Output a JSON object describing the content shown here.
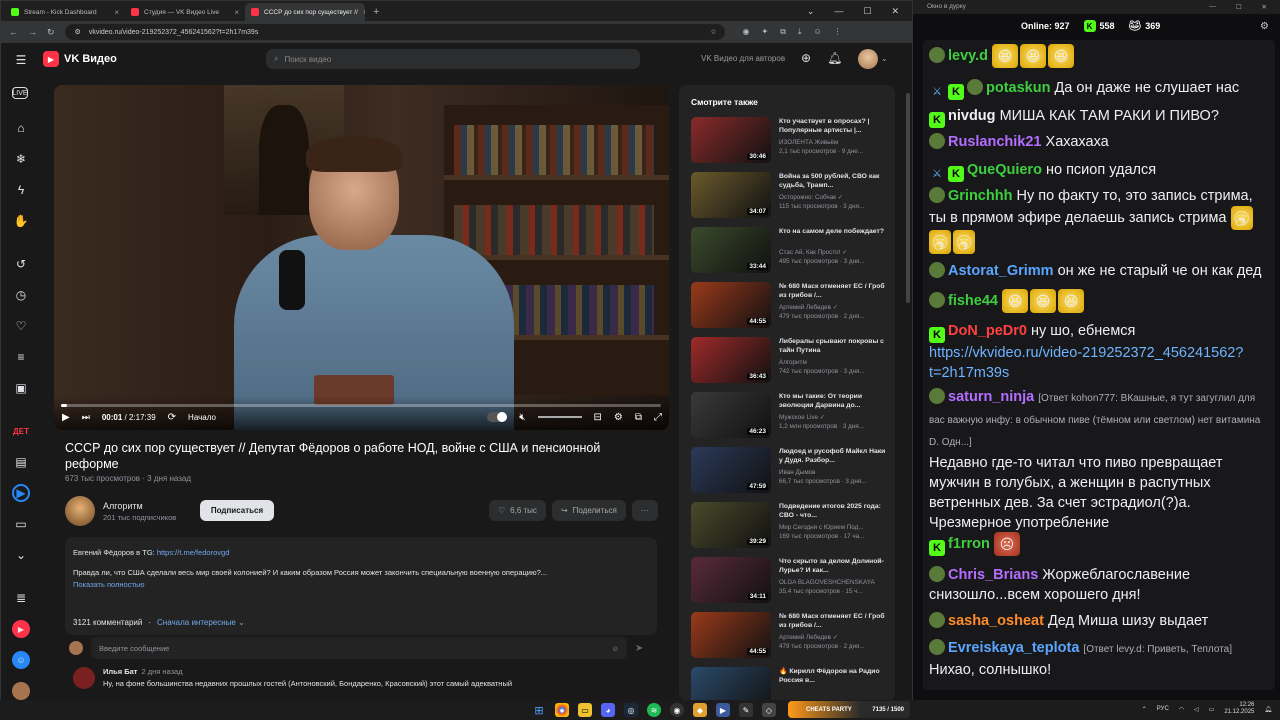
{
  "browser": {
    "tabs": [
      {
        "label": "Stream - Kick Dashboard",
        "color": "#53fc18"
      },
      {
        "label": "Студия — VK Видео Live",
        "color": "#ff3347"
      },
      {
        "label": "СССР до сих пор существует //",
        "color": "#ff3347",
        "active": true
      }
    ],
    "new_tab": "+",
    "url": "vkvideo.ru/video-219252372_456241562?t=2h17m39s"
  },
  "site": {
    "logo_text": "VK Видео",
    "search_placeholder": "Поиск видео",
    "authors_link": "VK Видео для авторов"
  },
  "player": {
    "time_current": "00:01",
    "time_total": "2:17:39",
    "chapter": "Начало",
    "progress": 0.01
  },
  "video": {
    "title": "СССР до сих пор существует // Депутат Фёдоров о работе НОД, войне с США и пенсионной реформе",
    "views": "673 тыс просмотров",
    "age": "3 дня назад",
    "channel_name": "Алгоритм",
    "channel_subs": "201 тыс подписчиков",
    "subscribe_label": "Подписаться",
    "likes": "6,6 тыс",
    "share_label": "Поделиться",
    "more_label": "···",
    "desc_line1_prefix": "Евгений Фёдоров в TG: ",
    "desc_line1_link": "https://t.me/fedorovgd",
    "desc_line2": "Правда ли, что США сделали весь мир своей колонией? И каким образом Россия может закончить специальную военную операцию?...",
    "desc_more": "Показать полностью",
    "comments_count": "3121 комментарий",
    "comments_sort": "Сначала интересные",
    "comment_placeholder": "Введите сообщение",
    "first_comment": {
      "author": "Илья Бат",
      "time": "2 дня назад",
      "text": "Ну, на фоне большинства недавних прошлых гостей (Антоновский, Бондаренко, Красовский) этот самый адекватный"
    }
  },
  "recs": {
    "heading": "Смотрите также",
    "items": [
      {
        "title": "Кто участвует в опросах? | Популярные артисты |...",
        "channel": "ИЗОЛЕНТА Живьём",
        "views": "2,1 тыс просмотров · 9 дне...",
        "dur": "30:46",
        "color": "#8a2b2b"
      },
      {
        "title": "Война за 500 рублей, СВО как судьба, Трамп...",
        "channel": "Осторожно: Собчак ✓",
        "views": "115 тыс просмотров · 3 дня...",
        "dur": "34:07",
        "color": "#6a5a2b"
      },
      {
        "title": "Кто на самом деле побеждает?",
        "channel": "Стас Ай, Как Просто! ✓",
        "views": "495 тыс просмотров · 3 дня...",
        "dur": "33:44",
        "color": "#3a4a2b"
      },
      {
        "title": "№ 680 Маск отменяет ЕС / Гроб из грибов /...",
        "channel": "Артемий Лебедев ✓",
        "views": "479 тыс просмотров · 2 дня...",
        "dur": "44:55",
        "color": "#9a3a1b"
      },
      {
        "title": "Либералы срывают покровы с тайн Путина",
        "channel": "Алгоритм",
        "views": "742 тыс просмотров · 3 дня...",
        "dur": "36:43",
        "color": "#a02a2a"
      },
      {
        "title": "Кто мы такие: От теории эволюции Дарвина до...",
        "channel": "Мужское Live ✓",
        "views": "1,2 млн просмотров · 3 дня...",
        "dur": "46:23",
        "color": "#3a3a3a"
      },
      {
        "title": "Людоед и русофоб Майкл Наки у Дудя. Разбор...",
        "channel": "Иван Дымов",
        "views": "66,7 тыс просмотров · 3 дня...",
        "dur": "47:59",
        "color": "#2b3a5a"
      },
      {
        "title": "Подведение итогов 2025 года: СВО - что...",
        "channel": "Мир Сегодня с Юрием Под...",
        "views": "169 тыс просмотров · 17 ча...",
        "dur": "39:29",
        "color": "#4a4a2b"
      },
      {
        "title": "Что скрыто за делом Долиной-Лурье? И как...",
        "channel": "OLGA BLAGOVESHCHENSKAYA",
        "views": "35,4 тыс просмотров · 15 ч...",
        "dur": "34:11",
        "color": "#5a2b3a"
      },
      {
        "title": "№ 680 Маск отменяет ЕС / Гроб из грибов /...",
        "channel": "Артемий Лебедев ✓",
        "views": "479 тыс просмотров · 2 дня...",
        "dur": "44:55",
        "color": "#9a3a1b"
      },
      {
        "title": "🔥 Кирилл Фёдоров на Радио Россия в...",
        "channel": "",
        "views": "",
        "dur": "",
        "color": "#2b4a6a"
      }
    ]
  },
  "chat": {
    "window_title": "Окно в дурку",
    "online_label": "Online:",
    "online_count": "927",
    "kick_count": "558",
    "pepe_count": "369",
    "messages": [
      {
        "user": "levy.d",
        "color": "#3ecf3e",
        "text": "",
        "emotes": 3
      },
      {
        "user": "potaskun",
        "color": "#3ecf3e",
        "text": "Да он даже не слушает нас"
      },
      {
        "user": "nivdug",
        "color": "#efeff1",
        "text": "МИША КАК ТАМ РАКИ И ПИВО?"
      },
      {
        "user": "Ruslanchik21",
        "color": "#b46dff",
        "text": "Хахахаха"
      },
      {
        "user": "QueQuiero",
        "color": "#3ecf3e",
        "text": "но псиоп удался"
      },
      {
        "user": "Grinchhh",
        "color": "#3ecf3e",
        "text": "Ну по факту то, это запись стрима, ты в прямом эфире делаешь запись стрима"
      },
      {
        "user": "Astorat_Grimm",
        "color": "#5aa6ff",
        "text": "он же не старый че он как дед"
      },
      {
        "user": "fishe44",
        "color": "#3ecf3e",
        "text": "",
        "emotes": 3
      },
      {
        "user": "DoN_peDr0",
        "color": "#ff4040",
        "text": "ну шо, ебнемся",
        "link": "https://vkvideo.ru/video-219252372_456241562?t=2h17m39s"
      },
      {
        "user": "saturn_ninja",
        "color": "#b46dff",
        "reply": "[Ответ kohon777: ВКашные, я тут загуглил для вас важную инфу: в обычном пиве (тёмном или светлом) нет витамина D. Одн...]",
        "text": "Недавно где-то читал что пиво превращает мужчин в голубых, а женщин в распутных ветренных дев. За счет эстрадиол(?)а. Чрезмерное употребление"
      },
      {
        "user": "f1rron",
        "color": "#3ecf3e",
        "text": ""
      },
      {
        "user": "Chris_Brians",
        "color": "#b46dff",
        "text": "Жоржеблагославение снизошло...всем хорошего дня!"
      },
      {
        "user": "sasha_osheat",
        "color": "#ff8c2a",
        "text": "Дед Миша шизу выдает"
      },
      {
        "user": "Evreiskaya_teplota",
        "color": "#5aa6ff",
        "reply": "[Ответ levy.d: Приветь, Теплота]",
        "text": "Нихао, солнышко!"
      }
    ]
  },
  "taskbar": {
    "lang": "РУС",
    "time": "12:26",
    "date": "21.12.2025",
    "game_label": "CHEATS PARTY",
    "game_stat": "7135 / 1500"
  }
}
